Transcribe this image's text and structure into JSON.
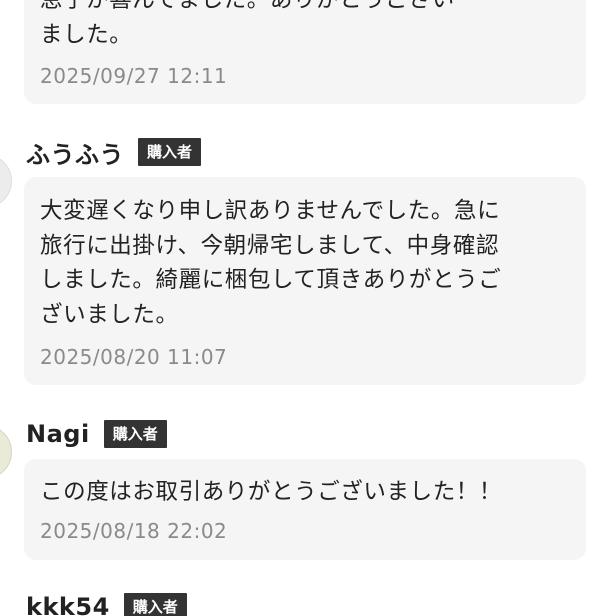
{
  "reviews": [
    {
      "message": "息子が喜んでました。ありがとうござい\nました。",
      "timestamp": "2025/09/27 12:11"
    },
    {
      "name": "ふうふう",
      "badge": "購入者",
      "message": "大変遅くなり申し訳ありませんでした。急に\n旅行に出掛け、今朝帰宅しまして、中身確認\nしました。綺麗に梱包して頂きありがとうご\nざいました。",
      "timestamp": "2025/08/20 11:07"
    },
    {
      "name": "Nagi",
      "badge": "購入者",
      "message": "この度はお取引ありがとうございました！！",
      "timestamp": "2025/08/18 22:02"
    },
    {
      "name": "kkk54",
      "badge": "購入者"
    }
  ]
}
